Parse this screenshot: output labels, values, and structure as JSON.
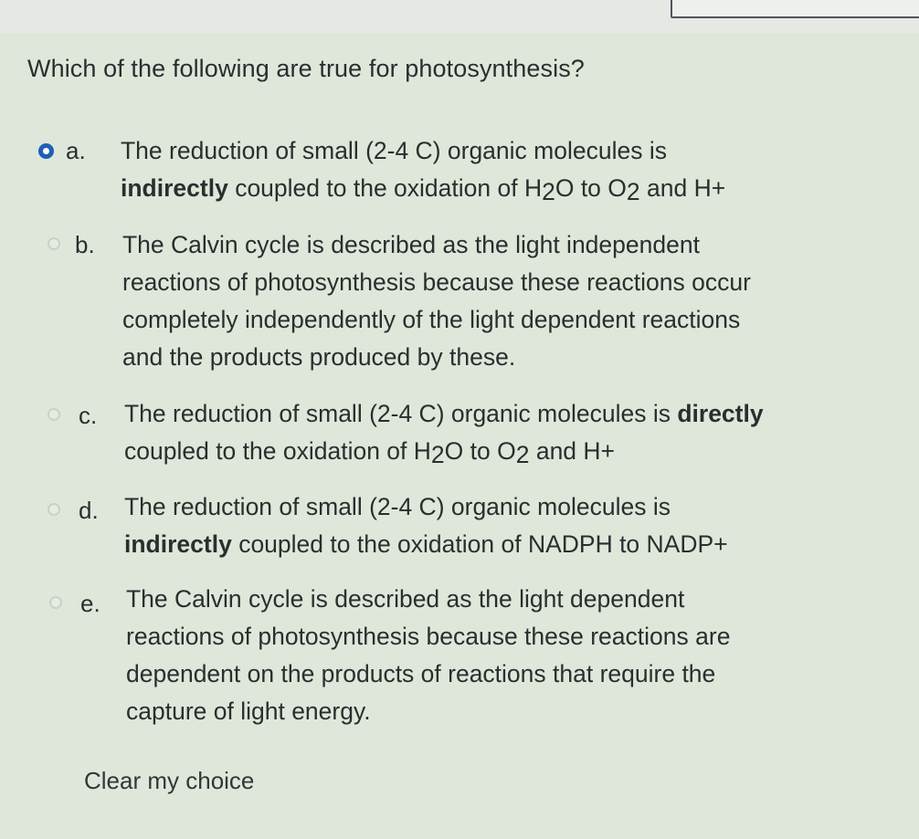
{
  "question": "Which of the following are true for photosynthesis?",
  "options": [
    {
      "letter": "a.",
      "selected": true,
      "lines": [
        [
          "The reduction of small (2-4 C) organic molecules is"
        ],
        [
          "indirectly",
          " coupled to the oxidation of H",
          "2",
          "O to O",
          "2",
          " and H+"
        ]
      ]
    },
    {
      "letter": "b.",
      "selected": false,
      "lines": [
        [
          "The Calvin cycle is described as the light independent"
        ],
        [
          "reactions of photosynthesis because these reactions occur"
        ],
        [
          "completely independently of the light dependent reactions"
        ],
        [
          "and the products produced by these."
        ]
      ]
    },
    {
      "letter": "c.",
      "selected": false,
      "lines": [
        [
          "The reduction of small (2-4 C) organic molecules is ",
          "directly"
        ],
        [
          "coupled to the oxidation of H",
          "2",
          "O to O",
          "2",
          " and H+"
        ]
      ]
    },
    {
      "letter": "d.",
      "selected": false,
      "lines": [
        [
          "The reduction of small (2-4 C) organic molecules is"
        ],
        [
          "indirectly",
          " coupled to the oxidation of NADPH to NADP+"
        ]
      ]
    },
    {
      "letter": "e.",
      "selected": false,
      "lines": [
        [
          "The Calvin cycle is described as the light dependent"
        ],
        [
          "reactions of photosynthesis because these reactions are"
        ],
        [
          "dependent on the products of reactions that require the"
        ],
        [
          "capture of light energy."
        ]
      ]
    }
  ],
  "clear_choice": "Clear my choice"
}
